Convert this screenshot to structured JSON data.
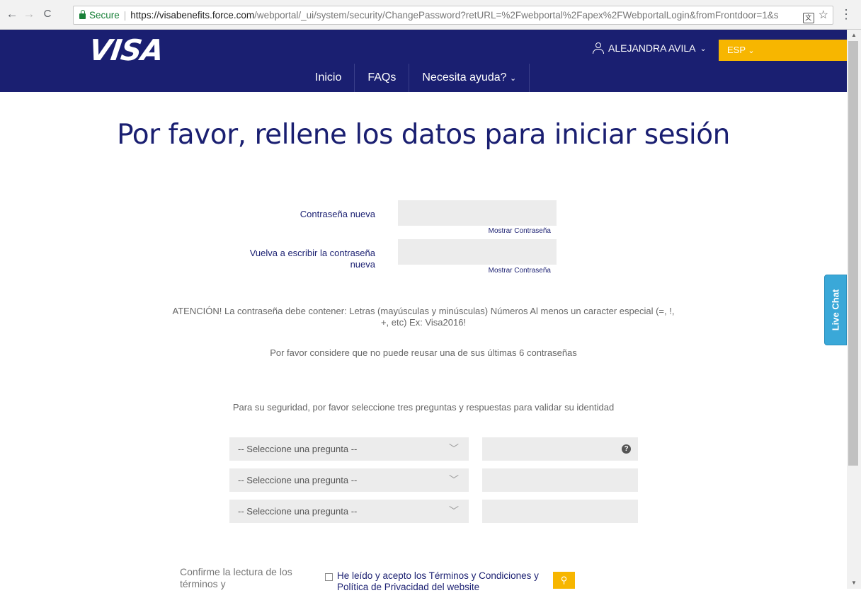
{
  "browser": {
    "back": "←",
    "forward": "→",
    "reload": "C",
    "secure_label": "Secure",
    "url_host": "https://visabenefits.force.com",
    "url_rest": "/webportal/_ui/system/security/ChangePassword?retURL=%2Fwebportal%2Fapex%2FWebportalLogin&fromFrontdoor=1&s",
    "menu": "⋮"
  },
  "header": {
    "logo": "VISA",
    "user_name": "ALEJANDRA AVILA",
    "language": "ESP",
    "nav": [
      "Inicio",
      "FAQs",
      "Necesita ayuda?"
    ]
  },
  "page": {
    "title": "Por favor, rellene los datos para iniciar sesión",
    "new_password_label": "Contraseña nueva",
    "retype_password_label": "Vuelva a escribir la contraseña nueva",
    "show_password": "Mostrar Contraseña",
    "attention_line1": "ATENCIÓN! La contraseña debe contener: Letras (mayúsculas y minúsculas) Números Al menos un caracter especial (=, !,",
    "attention_line2": "+, etc) Ex: Visa2016!",
    "reuse_note": "Por favor considere que no puede reusar una de sus últimas 6 contraseñas",
    "security_note": "Para su seguridad, por favor seleccione tres preguntas y respuestas para validar su identidad",
    "question_placeholder": "-- Seleccione una pregunta --",
    "terms_label": "Confirme la lectura de los términos y",
    "terms_link": "He leído y acepto los Términos y Condiciones y Política de Privacidad del website"
  },
  "live_chat": "Live Chat",
  "colors": {
    "brand_blue": "#1a1f71",
    "accent_gold": "#f7b600",
    "chat_blue": "#3aa8d8"
  }
}
